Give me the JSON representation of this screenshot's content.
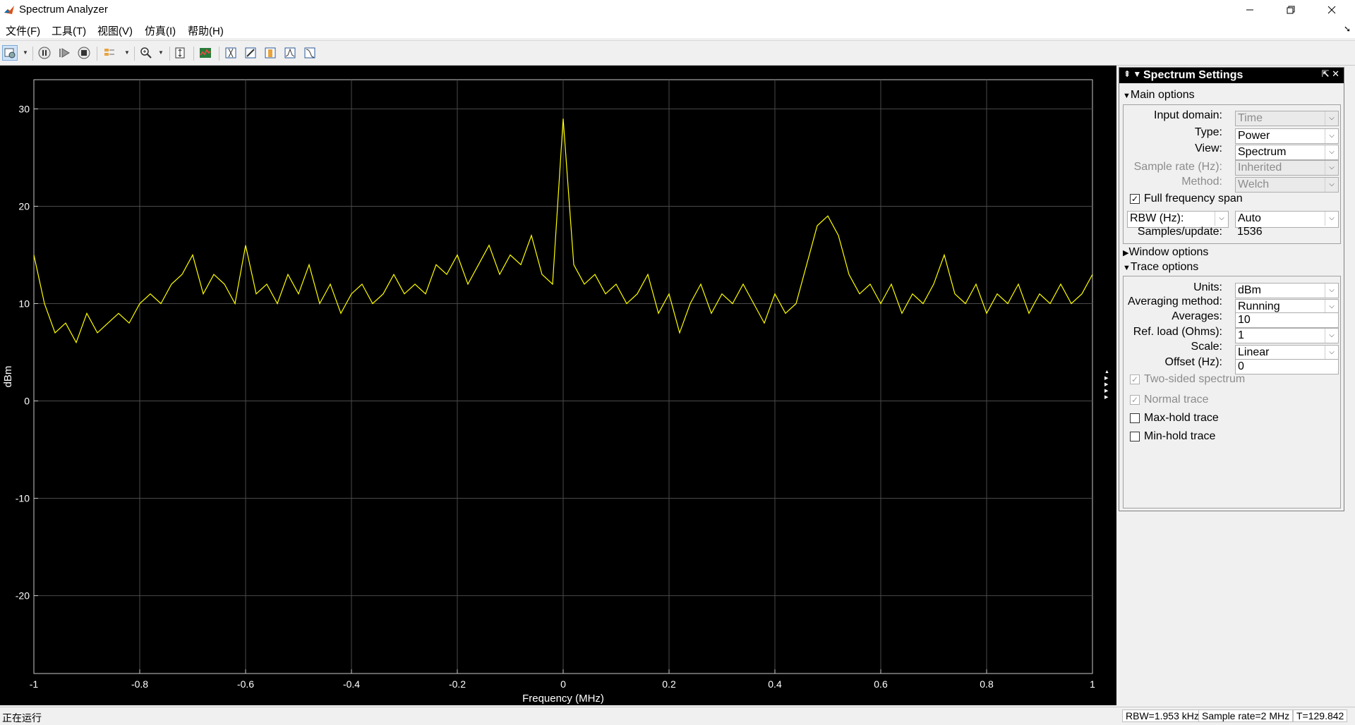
{
  "window": {
    "title": "Spectrum Analyzer",
    "icon": "matlab-icon",
    "controls": [
      "minimize-icon",
      "restore-icon",
      "close-icon"
    ]
  },
  "menu": {
    "items": [
      "文件(F)",
      "工具(T)",
      "视图(V)",
      "仿真(I)",
      "帮助(H)"
    ]
  },
  "toolbar": {
    "buttons": [
      "settings-icon",
      "pause-icon",
      "step-forward-icon",
      "stop-icon",
      "highlight-icon",
      "zoom-icon",
      "scale-axes-icon",
      "spectrum-settings-icon",
      "cursor-measurements-icon",
      "channel-measurements-icon",
      "distortion-measurements-icon",
      "peak-finder-icon",
      "ccdf-icon"
    ]
  },
  "plot": {
    "background": "#000000",
    "trace_color": "#ffff00",
    "grid_color": "#4a4a4a",
    "xlabel": "Frequency (MHz)",
    "ylabel": "dBm"
  },
  "chart_data": {
    "type": "line",
    "title": "",
    "xlabel": "Frequency (MHz)",
    "ylabel": "dBm",
    "xlim": [
      -1,
      1
    ],
    "ylim": [
      -28,
      33
    ],
    "xticks": [
      -1,
      -0.8,
      -0.6,
      -0.4,
      -0.2,
      0,
      0.2,
      0.4,
      0.6,
      0.8,
      1
    ],
    "xtick_labels": [
      "-1",
      "-0.8",
      "-0.6",
      "-0.4",
      "-0.2",
      "0",
      "0.2",
      "0.4",
      "0.6",
      "0.8",
      "1"
    ],
    "yticks": [
      30,
      20,
      10,
      0,
      -10,
      -20
    ],
    "ytick_labels": [
      "30",
      "20",
      "10",
      "0",
      "-10",
      "-20"
    ],
    "grid": true,
    "series": [
      {
        "color": "#ffff00",
        "x": [
          -1,
          -0.98,
          -0.96,
          -0.94,
          -0.92,
          -0.9,
          -0.88,
          -0.86,
          -0.84,
          -0.82,
          -0.8,
          -0.78,
          -0.76,
          -0.74,
          -0.72,
          -0.7,
          -0.68,
          -0.66,
          -0.64,
          -0.62,
          -0.6,
          -0.58,
          -0.56,
          -0.54,
          -0.52,
          -0.5,
          -0.48,
          -0.46,
          -0.44,
          -0.42,
          -0.4,
          -0.38,
          -0.36,
          -0.34,
          -0.32,
          -0.3,
          -0.28,
          -0.26,
          -0.24,
          -0.22,
          -0.2,
          -0.18,
          -0.16,
          -0.14,
          -0.12,
          -0.1,
          -0.08,
          -0.06,
          -0.04,
          -0.02,
          0,
          0.02,
          0.04,
          0.06,
          0.08,
          0.1,
          0.12,
          0.14,
          0.16,
          0.18,
          0.2,
          0.22,
          0.24,
          0.26,
          0.28,
          0.3,
          0.32,
          0.34,
          0.36,
          0.38,
          0.4,
          0.42,
          0.44,
          0.46,
          0.48,
          0.5,
          0.52,
          0.54,
          0.56,
          0.58,
          0.6,
          0.62,
          0.64,
          0.66,
          0.68,
          0.7,
          0.72,
          0.74,
          0.76,
          0.78,
          0.8,
          0.82,
          0.84,
          0.86,
          0.88,
          0.9,
          0.92,
          0.94,
          0.96,
          0.98,
          1
        ],
        "y": [
          15,
          10,
          7,
          8,
          6,
          9,
          7,
          8,
          9,
          8,
          10,
          11,
          10,
          12,
          13,
          15,
          11,
          13,
          12,
          10,
          16,
          11,
          12,
          10,
          13,
          11,
          14,
          10,
          12,
          9,
          11,
          12,
          10,
          11,
          13,
          11,
          12,
          11,
          14,
          13,
          15,
          12,
          14,
          16,
          13,
          15,
          14,
          17,
          13,
          12,
          29,
          14,
          12,
          13,
          11,
          12,
          10,
          11,
          13,
          9,
          11,
          7,
          10,
          12,
          9,
          11,
          10,
          12,
          10,
          8,
          11,
          9,
          10,
          14,
          18,
          19,
          17,
          13,
          11,
          12,
          10,
          12,
          9,
          11,
          10,
          12,
          15,
          11,
          10,
          12,
          9,
          11,
          10,
          12,
          9,
          11,
          10,
          12,
          10,
          11,
          13
        ]
      }
    ]
  },
  "settings": {
    "header": "Spectrum Settings",
    "header_left_icons": "⇞ ▼",
    "header_right_icons": "⇱ ✕",
    "main_options": "Main options",
    "input_domain_label": "Input domain:",
    "input_domain_value": "Time",
    "type_label": "Type:",
    "type_value": "Power",
    "view_label": "View:",
    "view_value": "Spectrum",
    "sample_rate_label": "Sample rate (Hz):",
    "sample_rate_value": "Inherited",
    "method_label": "Method:",
    "method_value": "Welch",
    "full_span_label": "Full frequency span",
    "rbw_label": "RBW (Hz):",
    "rbw_value": "Auto",
    "samples_update_label": "Samples/update:",
    "samples_update_value": "1536",
    "window_options": "Window options",
    "trace_options": "Trace options",
    "units_label": "Units:",
    "units_value": "dBm",
    "averaging_method_label": "Averaging method:",
    "averaging_method_value": "Running",
    "averages_label": "Averages:",
    "averages_value": "10",
    "ref_load_label": "Ref. load (Ohms):",
    "ref_load_value": "1",
    "scale_label": "Scale:",
    "scale_value": "Linear",
    "offset_label": "Offset (Hz):",
    "offset_value": "0",
    "two_sided_label": "Two-sided spectrum",
    "normal_trace_label": "Normal trace",
    "max_hold_label": "Max-hold trace",
    "min_hold_label": "Min-hold trace"
  },
  "status": {
    "running": "正在运行",
    "rbw": "RBW=1.953 kHz",
    "sample_rate": "Sample rate=2 MHz",
    "time": "T=129.842"
  }
}
